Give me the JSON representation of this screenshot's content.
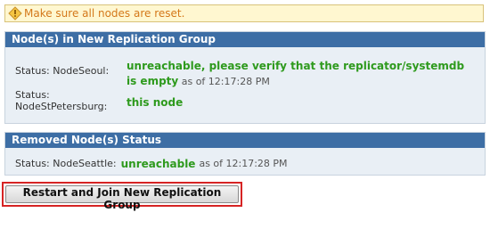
{
  "warning": {
    "icon": "warning-diamond-icon",
    "text": "Make sure all nodes are reset."
  },
  "new_group": {
    "title": "Node(s) in New Replication Group",
    "nodes": [
      {
        "label": "Status: NodeSeoul:",
        "status": "unreachable, please verify that the replicator/systemdb is empty",
        "as_of": "as of 12:17:28 PM"
      },
      {
        "label": "Status: NodeStPetersburg:",
        "status": "this node"
      }
    ]
  },
  "removed": {
    "title": "Removed Node(s) Status",
    "nodes": [
      {
        "label": "Status: NodeSeattle:",
        "status": "unreachable",
        "as_of": "as of 12:17:28 PM"
      }
    ]
  },
  "action": {
    "button_label": "Restart and Join New Replication Group"
  },
  "colors": {
    "panel_header": "#3d6ea5",
    "status_green": "#2e9a1d",
    "warning_text": "#d4781a",
    "highlight_border": "#d62424"
  }
}
